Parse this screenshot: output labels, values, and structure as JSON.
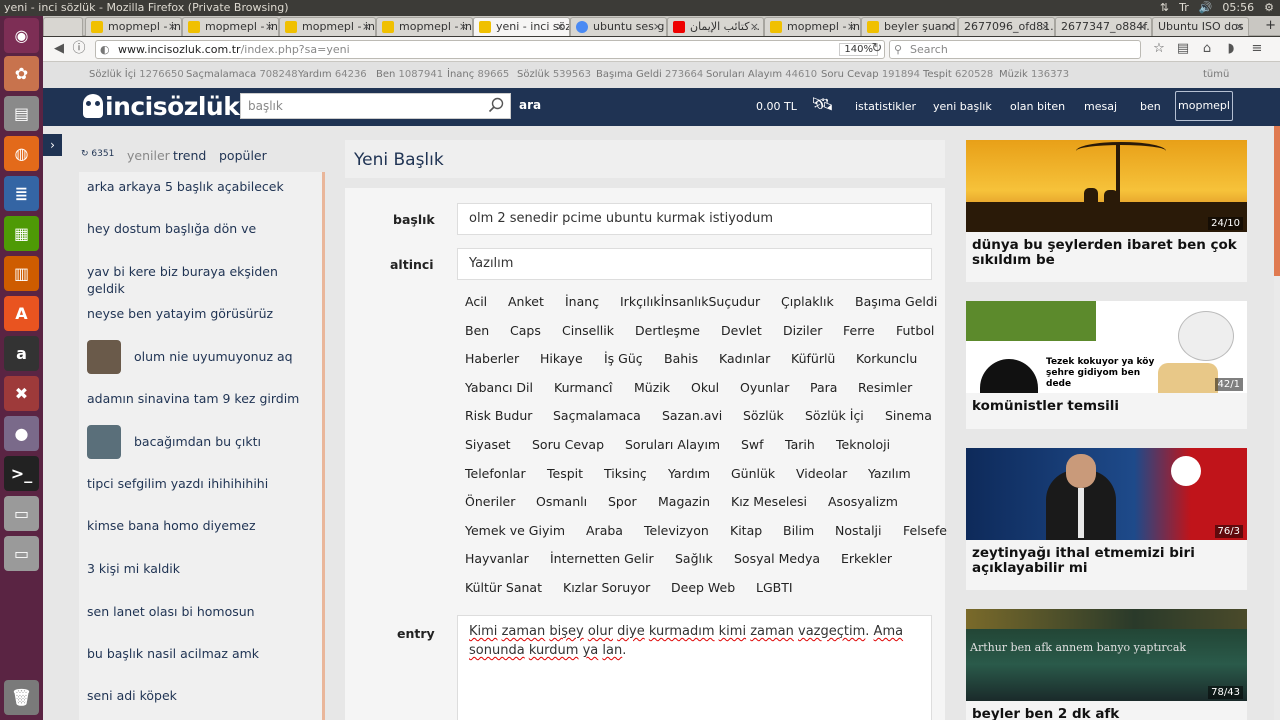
{
  "window": {
    "title": "yeni - inci sözlük - Mozilla Firefox (Private Browsing)",
    "clock": "05:56"
  },
  "tabs": [
    {
      "label": "mopmepl - in",
      "active": false
    },
    {
      "label": "mopmepl - in",
      "active": false
    },
    {
      "label": "mopmepl - in",
      "active": false
    },
    {
      "label": "mopmepl - in",
      "active": false
    },
    {
      "label": "yeni - inci söz",
      "active": true
    },
    {
      "label": "ubuntu ses g",
      "active": false
    },
    {
      "label": "كتائب الإيمان ..",
      "active": false
    },
    {
      "label": "mopmepl - in",
      "active": false
    },
    {
      "label": "beyler şuand",
      "active": false
    },
    {
      "label": "2677096_ofd81.",
      "active": false
    },
    {
      "label": "2677347_o884f.",
      "active": false
    },
    {
      "label": "Ubuntu ISO dos",
      "active": false
    }
  ],
  "nav": {
    "url_domain": "www.incisozluk.com.tr",
    "url_path": "/index.php?sa=yeni",
    "zoom": "140%",
    "search_placeholder": "Search"
  },
  "stats": [
    {
      "label": "Sözlük İçi",
      "count": "1276650"
    },
    {
      "label": "Saçmalamaca",
      "count": "708248"
    },
    {
      "label": "Yardım",
      "count": "64236"
    },
    {
      "label": "Ben",
      "count": "1087941"
    },
    {
      "label": "İnanç",
      "count": "89665"
    },
    {
      "label": "Sözlük",
      "count": "539563"
    },
    {
      "label": "Başıma Geldi",
      "count": "273664"
    },
    {
      "label": "Soruları Alayım",
      "count": "44610"
    },
    {
      "label": "Soru Cevap",
      "count": "191894"
    },
    {
      "label": "Tespit",
      "count": "620528"
    },
    {
      "label": "Müzik",
      "count": "136373"
    }
  ],
  "stats_all": "tümü",
  "header": {
    "logo": "incisözlük",
    "search_placeholder": "başlık",
    "search_button": "ara",
    "balance": "0.00 TL",
    "links": [
      "istatistikler",
      "yeni başlık",
      "olan biten",
      "mesaj",
      "ben"
    ],
    "user": "mopmepl"
  },
  "left": {
    "count": "6351",
    "tabs": [
      "yeniler",
      "trend",
      "popüler"
    ],
    "items": [
      "arka arkaya 5 başlık açabilecek",
      "hey dostum başlığa dön ve",
      "yav bi kere biz buraya ekşiden geldik",
      "neyse ben yatayim görüsürüz",
      "olum nie uyumuyonuz aq",
      "adamın sinavina tam 9 kez girdim",
      "bacağımdan bu çıktı",
      "tipci sefgilim yazdı ihihihihihi",
      "kimse bana homo diyemez",
      "3 kişi mi kaldik",
      "sen lanet olası bi homosun",
      "bu başlık nasil acilmaz amk",
      "seni adi köpek"
    ]
  },
  "form": {
    "page_title": "Yeni Başlık",
    "title_label": "başlık",
    "title_value": "olm 2 senedir pcime ubuntu kurmak istiyodum",
    "category_label": "altinci",
    "category_value": "Yazılım",
    "categories": [
      [
        "Acil",
        "Anket",
        "İnanç",
        "IrkçılıkİnsanlıkSuçudur",
        "Çıplaklık",
        "Başıma Geldi"
      ],
      [
        "Ben",
        "Caps",
        "Cinsellik",
        "Dertleşme",
        "Devlet",
        "Diziler",
        "Ferre",
        "Futbol"
      ],
      [
        "Haberler",
        "Hikaye",
        "İş Güç",
        "Bahis",
        "Kadınlar",
        "Küfürlü",
        "Korkunclu"
      ],
      [
        "Yabancı Dil",
        "Kurmancî",
        "Müzik",
        "Okul",
        "Oyunlar",
        "Para",
        "Resimler"
      ],
      [
        "Risk Budur",
        "Saçmalamaca",
        "Sazan.avi",
        "Sözlük",
        "Sözlük İçi",
        "Sinema"
      ],
      [
        "Siyaset",
        "Soru Cevap",
        "Soruları Alayım",
        "Swf",
        "Tarih",
        "Teknoloji"
      ],
      [
        "Telefonlar",
        "Tespit",
        "Tiksinç",
        "Yardım",
        "Günlük",
        "Videolar",
        "Yazılım"
      ],
      [
        "Öneriler",
        "Osmanlı",
        "Spor",
        "Magazin",
        "Kız Meselesi",
        "Asosyalizm"
      ],
      [
        "Yemek ve Giyim",
        "Araba",
        "Televizyon",
        "Kitap",
        "Bilim",
        "Nostalji",
        "Felsefe"
      ],
      [
        "Hayvanlar",
        "İnternetten Gelir",
        "Sağlık",
        "Sosyal Medya",
        "Erkekler"
      ],
      [
        "Kültür Sanat",
        "Kızlar Soruyor",
        "Deep Web",
        "LGBTI"
      ]
    ],
    "entry_label": "entry",
    "entry_words": [
      "Kimi",
      " ",
      "zaman",
      " ",
      "bişey",
      " ",
      "olur",
      " ",
      "diye",
      " ",
      "kurmadım",
      " ",
      "kimi",
      " ",
      "zaman",
      " ",
      "vazgeçtim",
      ". ",
      "Ama",
      " ",
      "sonunda",
      " ",
      "kurdum",
      " ",
      "ya",
      " ",
      "lan",
      "."
    ]
  },
  "cards": [
    {
      "title": "dünya bu şeylerden ibaret ben çok sıkıldım be",
      "badge": "24/10",
      "overlay": ""
    },
    {
      "title": "komünistler temsili",
      "badge": "42/1",
      "overlay": "Tezek kokuyor ya köy şehre gidiyom ben dede"
    },
    {
      "title": "zeytinyağı ithal etmemizi biri açıklayabilir mi",
      "badge": "76/3",
      "overlay": ""
    },
    {
      "title": "beyler ben 2 dk afk",
      "badge": "78/43",
      "overlay": "Arthur ben afk annem banyo yaptırcak"
    }
  ],
  "colors": {
    "header": "#1f3353",
    "accent": "#e07a50",
    "launcher": "#5a2443"
  }
}
